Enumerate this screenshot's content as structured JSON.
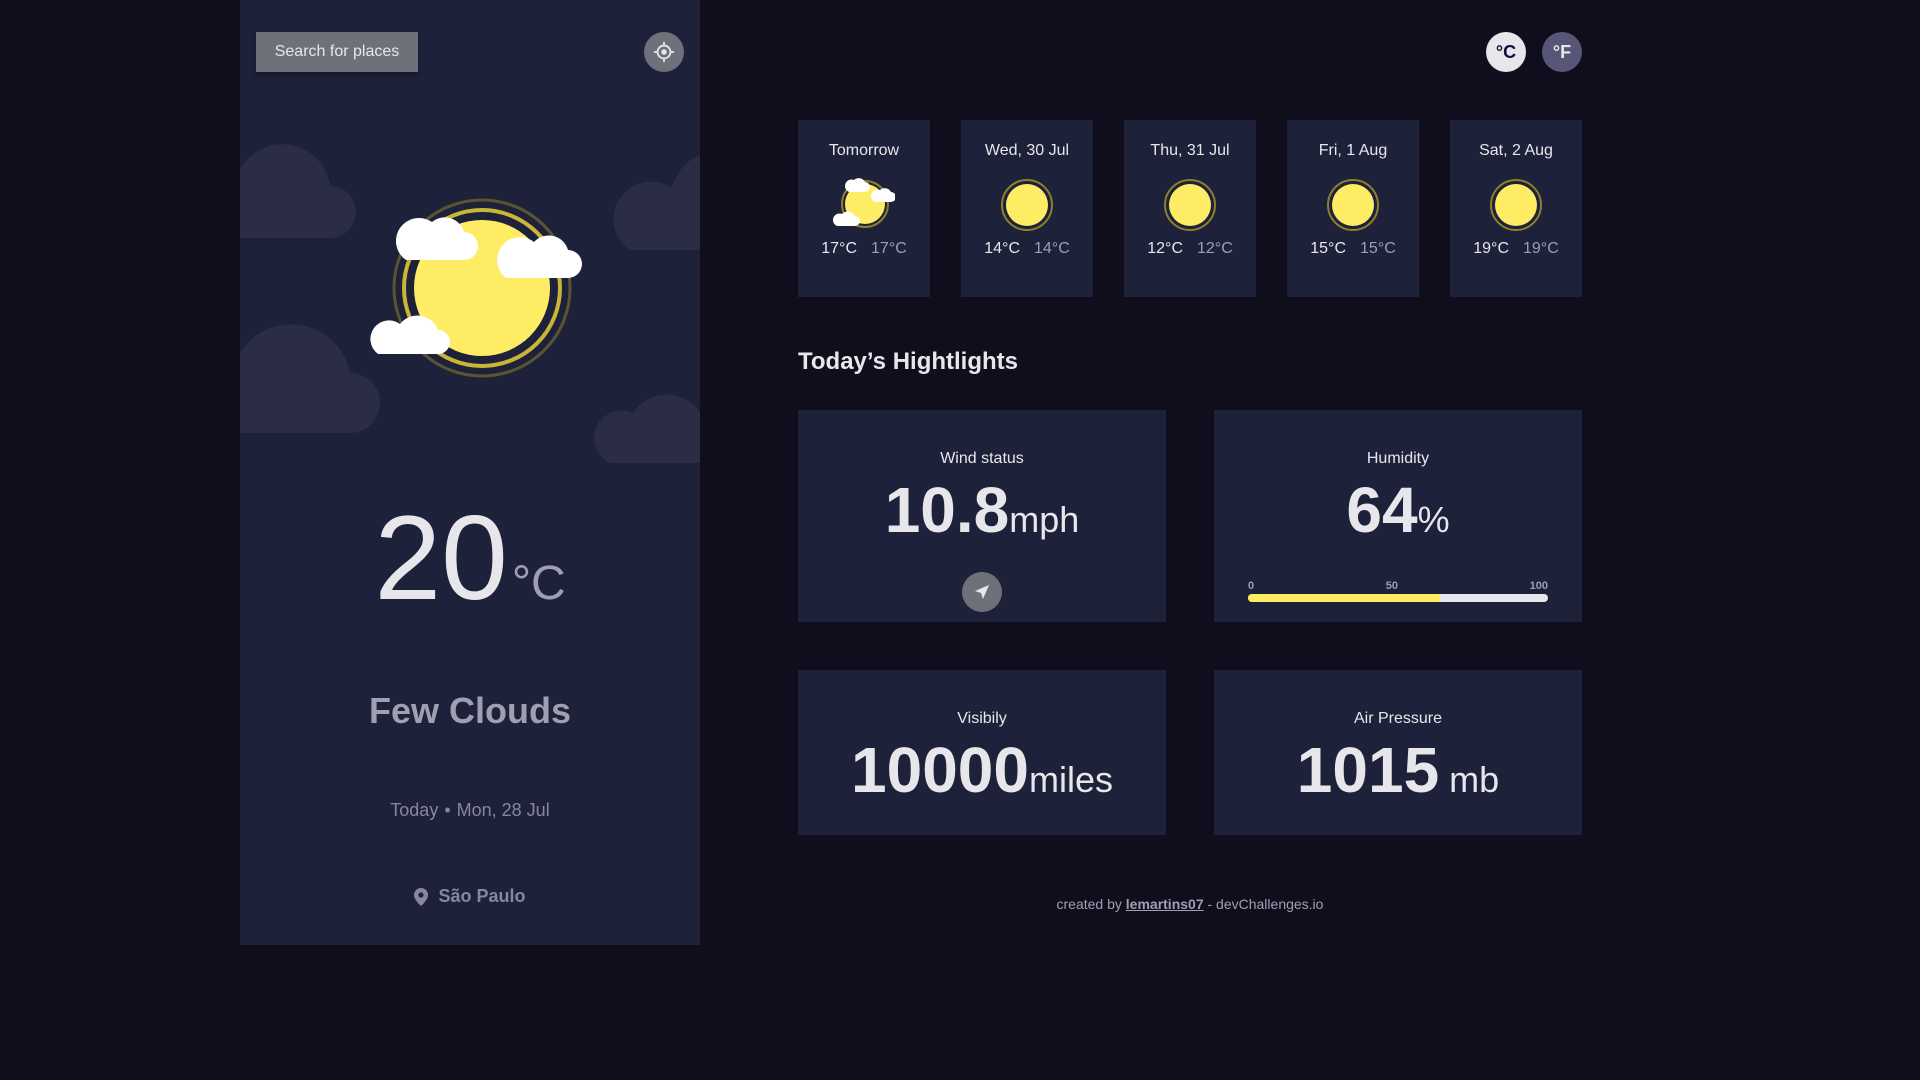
{
  "search": {
    "label": "Search for places"
  },
  "icons": {
    "locate": "crosshair-icon",
    "location": "map-pin-icon",
    "wind_direction": "navigation-arrow-icon"
  },
  "current": {
    "temp": "20",
    "unit": "°C",
    "condition": "Few Clouds",
    "today_label": "Today",
    "separator": "•",
    "date": "Mon, 28 Jul",
    "location": "São Paulo",
    "icon": "sun-with-clouds-icon"
  },
  "units": {
    "celsius": "°C",
    "fahrenheit": "°F",
    "selected": "celsius"
  },
  "forecast": [
    {
      "day": "Tomorrow",
      "max": "17°C",
      "min": "17°C",
      "icon": "sun-with-clouds-icon"
    },
    {
      "day": "Wed, 30 Jul",
      "max": "14°C",
      "min": "14°C",
      "icon": "sun-icon"
    },
    {
      "day": "Thu, 31 Jul",
      "max": "12°C",
      "min": "12°C",
      "icon": "sun-icon"
    },
    {
      "day": "Fri, 1 Aug",
      "max": "15°C",
      "min": "15°C",
      "icon": "sun-icon"
    },
    {
      "day": "Sat, 2 Aug",
      "max": "19°C",
      "min": "19°C",
      "icon": "sun-icon"
    }
  ],
  "highlights": {
    "title": "Today’s Hightlights",
    "wind": {
      "label": "Wind status",
      "value": "10.8",
      "unit": "mph"
    },
    "humidity": {
      "label": "Humidity",
      "value": "64",
      "unit": "%",
      "scale_min": "0",
      "scale_mid": "50",
      "scale_max": "100",
      "fraction": 0.64
    },
    "visibility": {
      "label": "Visibily",
      "value": "10000",
      "unit": "miles"
    },
    "pressure": {
      "label": "Air Pressure",
      "value": "1015",
      "unit": " mb"
    }
  },
  "footer": {
    "prefix": "created by ",
    "author": "lemartins07",
    "suffix": " - devChallenges.io"
  },
  "colors": {
    "background": "#100e1d",
    "panel": "#1e213a",
    "sun": "#ffec65",
    "text": "#e7e7eb",
    "muted": "#a09fb1"
  }
}
